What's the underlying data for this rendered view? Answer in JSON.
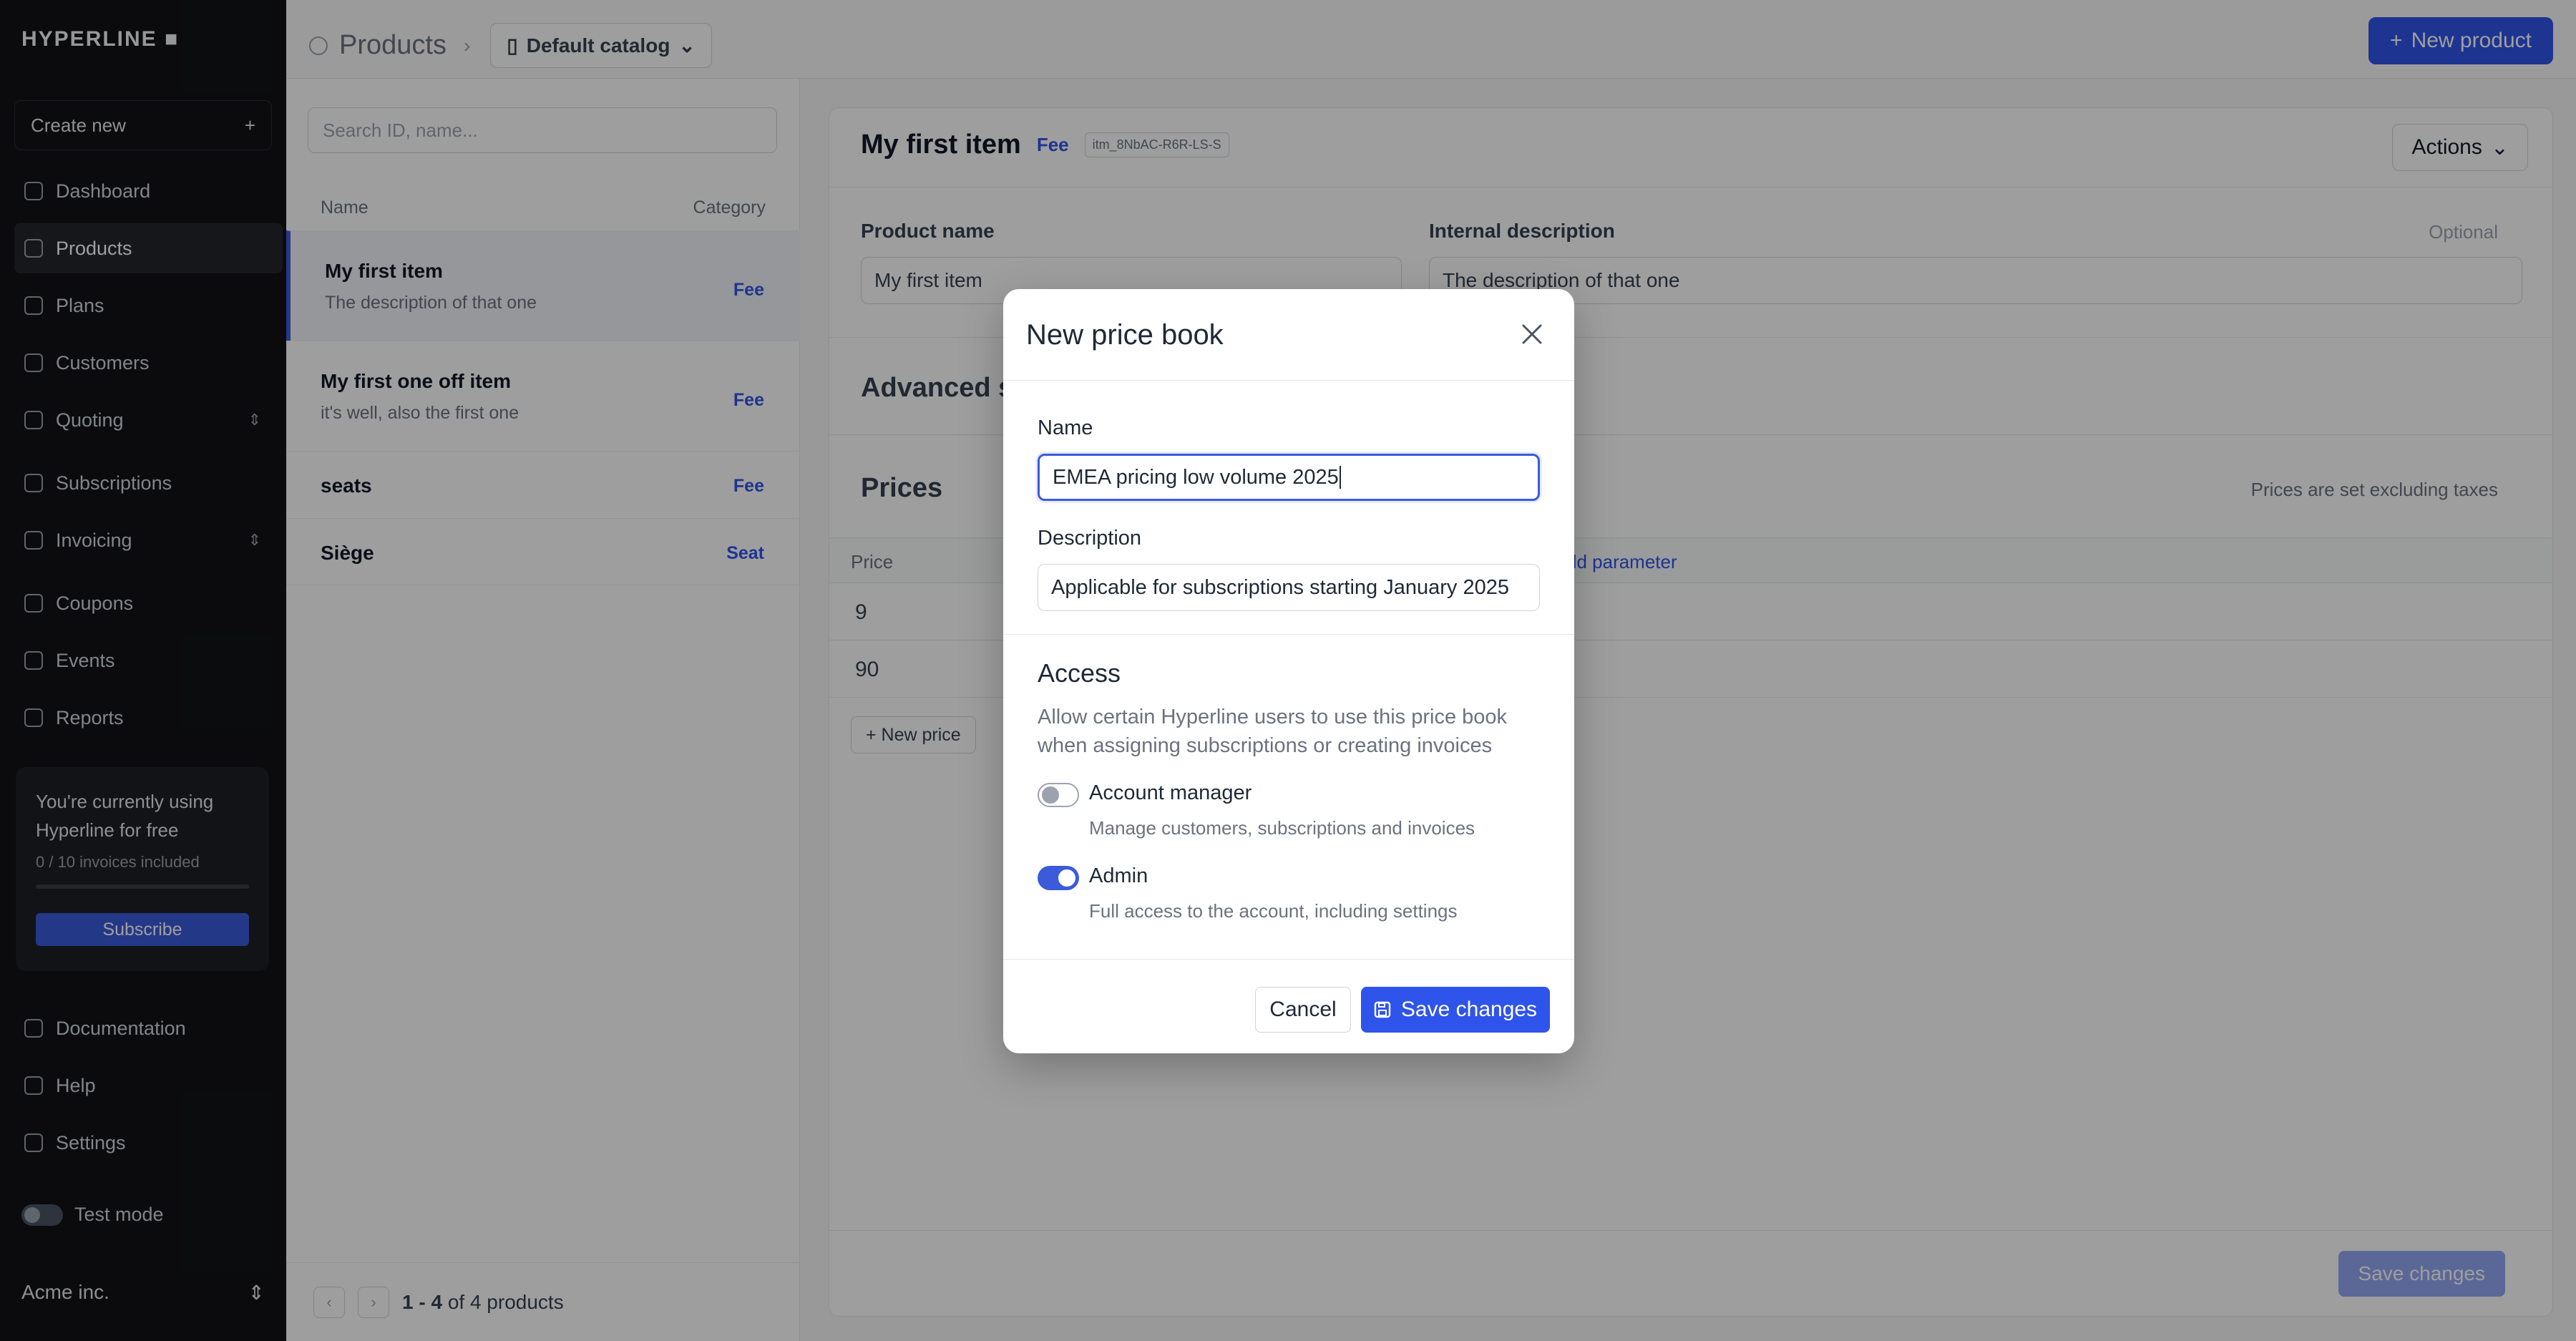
{
  "app": {
    "logo": "HYPERLINE ■"
  },
  "sidebar": {
    "create_new": "Create new",
    "items": [
      {
        "label": "Dashboard",
        "icon": "chart-icon"
      },
      {
        "label": "Products",
        "icon": "box-icon"
      },
      {
        "label": "Plans",
        "icon": "layers-icon"
      },
      {
        "label": "Customers",
        "icon": "users-icon"
      },
      {
        "label": "Quoting",
        "icon": "handshake-icon"
      },
      {
        "label": "Subscriptions",
        "icon": "refresh-icon"
      },
      {
        "label": "Invoicing",
        "icon": "invoice-icon"
      },
      {
        "label": "Coupons",
        "icon": "tag-icon"
      },
      {
        "label": "Events",
        "icon": "database-icon"
      },
      {
        "label": "Reports",
        "icon": "bar-chart-icon"
      }
    ],
    "promo": {
      "text": "You're currently using Hyperline for free",
      "invoices": "0 / 10 invoices included",
      "button": "Subscribe"
    },
    "bottom_items": [
      {
        "label": "Documentation",
        "icon": "book-icon"
      },
      {
        "label": "Help",
        "icon": "help-icon"
      },
      {
        "label": "Settings",
        "icon": "gear-icon"
      }
    ],
    "test_mode": "Test mode",
    "account": "Acme inc."
  },
  "topbar": {
    "breadcrumb": "Products",
    "catalog": "Default catalog",
    "new_product": "New product"
  },
  "list": {
    "search_placeholder": "Search ID, name...",
    "col_name": "Name",
    "col_category": "Category",
    "rows": [
      {
        "name": "My first item",
        "desc": "The description of that one",
        "tag": "Fee"
      },
      {
        "name": "My first one off item",
        "desc": "it's well, also the first one",
        "tag": "Fee"
      },
      {
        "name": "seats",
        "desc": "",
        "tag": "Fee"
      },
      {
        "name": "Siège",
        "desc": "",
        "tag": "Seat"
      }
    ],
    "pagination_range": "1 - 4",
    "pagination_total": "of 4 products"
  },
  "detail": {
    "title": "My first item",
    "tag": "Fee",
    "id": "itm_8NbAC-R6R-LS-S",
    "actions": "Actions",
    "product_name_label": "Product name",
    "product_name_value": "My first item",
    "internal_desc_label": "Internal description",
    "internal_desc_optional": "Optional",
    "internal_desc_value": "The description of that one",
    "advanced": "Advanced s",
    "prices_title": "Prices",
    "prices_note": "Prices are set excluding taxes",
    "price_col": "Price",
    "add_parameter": "dd parameter",
    "prices": [
      "9",
      "90"
    ],
    "new_price": "New price",
    "save_changes": "Save changes"
  },
  "modal": {
    "title": "New price book",
    "name_label": "Name",
    "name_value": "EMEA pricing low volume 2025",
    "description_label": "Description",
    "description_value": "Applicable for subscriptions starting January 2025",
    "access_title": "Access",
    "access_desc": "Allow certain Hyperline users to use this price book when assigning subscriptions or creating invoices",
    "options": [
      {
        "title": "Account manager",
        "desc": "Manage customers, subscriptions and invoices",
        "enabled": false
      },
      {
        "title": "Admin",
        "desc": "Full access to the account, including settings",
        "enabled": true
      }
    ],
    "cancel": "Cancel",
    "save": "Save changes"
  },
  "colors": {
    "accent": "#2f54eb",
    "sidebar_bg": "#121316"
  }
}
